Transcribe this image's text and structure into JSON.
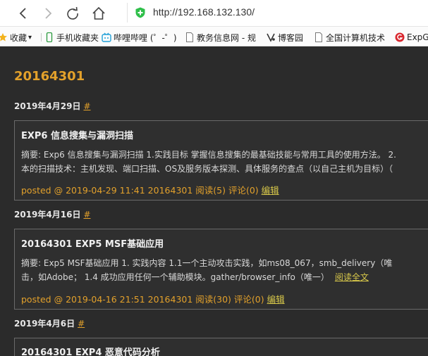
{
  "browser": {
    "url": "http://192.168.132.130/"
  },
  "bookmarks": [
    {
      "label": "收藏",
      "icon": "star-icon"
    },
    {
      "label": "手机收藏夹",
      "icon": "phone-icon"
    },
    {
      "label": "哔哩哔哩 (゜-゜)",
      "icon": "bilibili-icon"
    },
    {
      "label": "教务信息网 - 规",
      "icon": "page-icon"
    },
    {
      "label": "博客园",
      "icon": "cnblogs-icon"
    },
    {
      "label": "全国计算机技术",
      "icon": "page-icon"
    },
    {
      "label": "ExpG",
      "icon": "expg-icon"
    }
  ],
  "blog": {
    "title": "20164301",
    "days": [
      {
        "date": "2019年4月29日",
        "hash": "#",
        "post": {
          "title": "EXP6 信息搜集与漏洞扫描",
          "summary_line1": "摘要: Exp6 信息搜集与漏洞扫描 1.实践目标 掌握信息搜集的最基础技能与常用工具的使用方法。 2.",
          "summary_line2": "本的扫描技术：主机发现、端口扫描、OS及服务版本探测、具体服务的查点（以自己主机为目标）（",
          "readmore": "",
          "meta": "posted @ 2019-04-29 11:41 20164301 阅读(5) 评论(0)",
          "edit": "编辑"
        }
      },
      {
        "date": "2019年4月16日",
        "hash": "#",
        "post": {
          "title": "20164301 EXP5 MSF基础应用",
          "summary_line1": "摘要: Exp5 MSF基础应用 1. 实践内容 1.1一个主动攻击实践，如ms08_067，smb_delivery（唯",
          "summary_line2": "击，如Adobe； 1.4 成功应用任何一个辅助模块。gather/browser_info（唯一）",
          "readmore": "阅读全文",
          "meta": "posted @ 2019-04-16 21:51 20164301 阅读(30) 评论(0)",
          "edit": "编辑"
        }
      },
      {
        "date": "2019年4月6日",
        "hash": "#",
        "post": {
          "title": "20164301 EXP4 恶意代码分析"
        }
      }
    ]
  },
  "colors": {
    "accent": "#e3a12b",
    "background": "#2b2b2b",
    "link": "#d8c84a",
    "shield": "#2fbf4a"
  }
}
